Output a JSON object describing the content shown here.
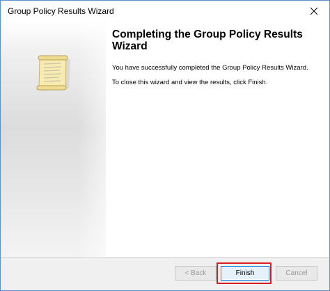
{
  "window": {
    "title": "Group Policy Results Wizard",
    "close_icon": "close-icon"
  },
  "sidebar": {
    "icon": "scroll-icon"
  },
  "main": {
    "heading": "Completing the Group Policy Results Wizard",
    "paragraph1": "You have successfully completed the Group Policy Results Wizard.",
    "paragraph2": "To close this wizard and view the results, click Finish."
  },
  "buttons": {
    "back_label": "< Back",
    "finish_label": "Finish",
    "cancel_label": "Cancel"
  },
  "colors": {
    "window_border": "#5b8fc7",
    "highlight_border": "#d81e1e",
    "default_button_border": "#0078d7",
    "footer_background": "#f0f0f0"
  }
}
